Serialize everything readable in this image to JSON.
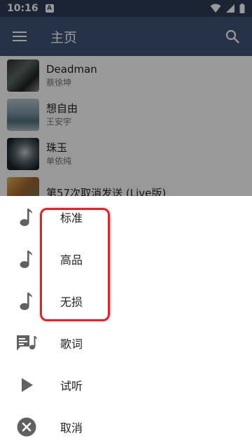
{
  "status_bar": {
    "time": "10:16",
    "notification_glyph": "A"
  },
  "app_bar": {
    "title": "主页"
  },
  "songs": [
    {
      "title": "Deadman",
      "artist": "蔡徐坤"
    },
    {
      "title": "想自由",
      "artist": "王安宇"
    },
    {
      "title": "珠玉",
      "artist": "单依纯"
    },
    {
      "title": "第57次取消发送 (Live版)",
      "artist": ""
    }
  ],
  "sheet": {
    "items": [
      {
        "label": "标准",
        "icon": "music-note-icon"
      },
      {
        "label": "高品",
        "icon": "music-note-icon"
      },
      {
        "label": "无损",
        "icon": "music-note-icon"
      },
      {
        "label": "歌词",
        "icon": "lyrics-icon"
      },
      {
        "label": "试听",
        "icon": "play-icon"
      },
      {
        "label": "取消",
        "icon": "cancel-icon"
      }
    ]
  },
  "colors": {
    "app_bar": "#3f5477",
    "status_bar": "#2e3d55",
    "highlight": "#e0242b",
    "icon": "#616161"
  }
}
